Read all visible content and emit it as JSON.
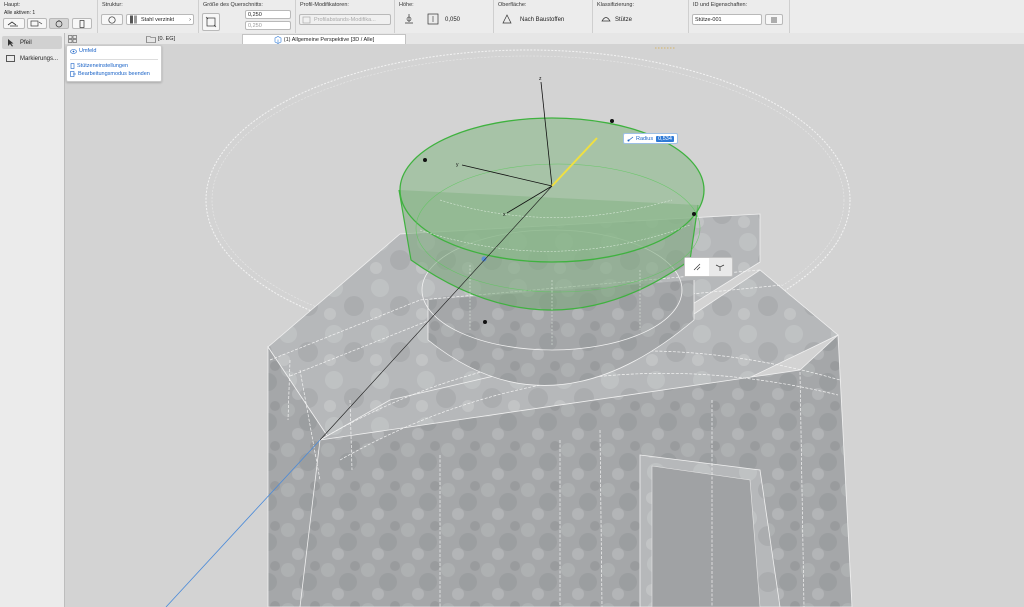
{
  "infobox": {
    "haupt": {
      "title": "Haupt:",
      "active_label": "Alle aktiven: 1"
    },
    "struktur": {
      "title": "Struktur:",
      "material": "Stahl verzinkt"
    },
    "querschnitt": {
      "title": "Größe des Querschnitts:",
      "value1": "0,250",
      "value2": "0,250"
    },
    "profil": {
      "title": "Profil-Modifikatoren:",
      "value": "Profilabstands-Modifika..."
    },
    "hoehe": {
      "title": "Höhe:",
      "value": "0,050"
    },
    "oberflaeche": {
      "title": "Oberfläche:",
      "value": "Nach Baustoffen"
    },
    "klassifizierung": {
      "title": "Klassifizierung:",
      "value": "Stütze"
    },
    "id": {
      "title": "ID und Eigenschaften:",
      "value": "Stütze-001"
    }
  },
  "tabs": {
    "floor": "[0. EG]",
    "view": "(1) Allgemeine Perspektive [3D / Alle]"
  },
  "toolbox": {
    "items": [
      {
        "label": "Pfeil"
      },
      {
        "label": "Markierungs..."
      }
    ]
  },
  "popup": {
    "items": [
      {
        "label": "Umfeld"
      },
      {
        "label": "Stützeneinstellungen"
      },
      {
        "label": "Bearbeitungsmodus beenden"
      }
    ]
  },
  "tooltip": {
    "label": "Radius",
    "value": "0,534"
  },
  "axes": {
    "z": "z",
    "y": "y",
    "x": "x"
  },
  "colors": {
    "selection": "#3fb23f",
    "highlight": "#f0e040",
    "accent": "#1a63c7"
  }
}
